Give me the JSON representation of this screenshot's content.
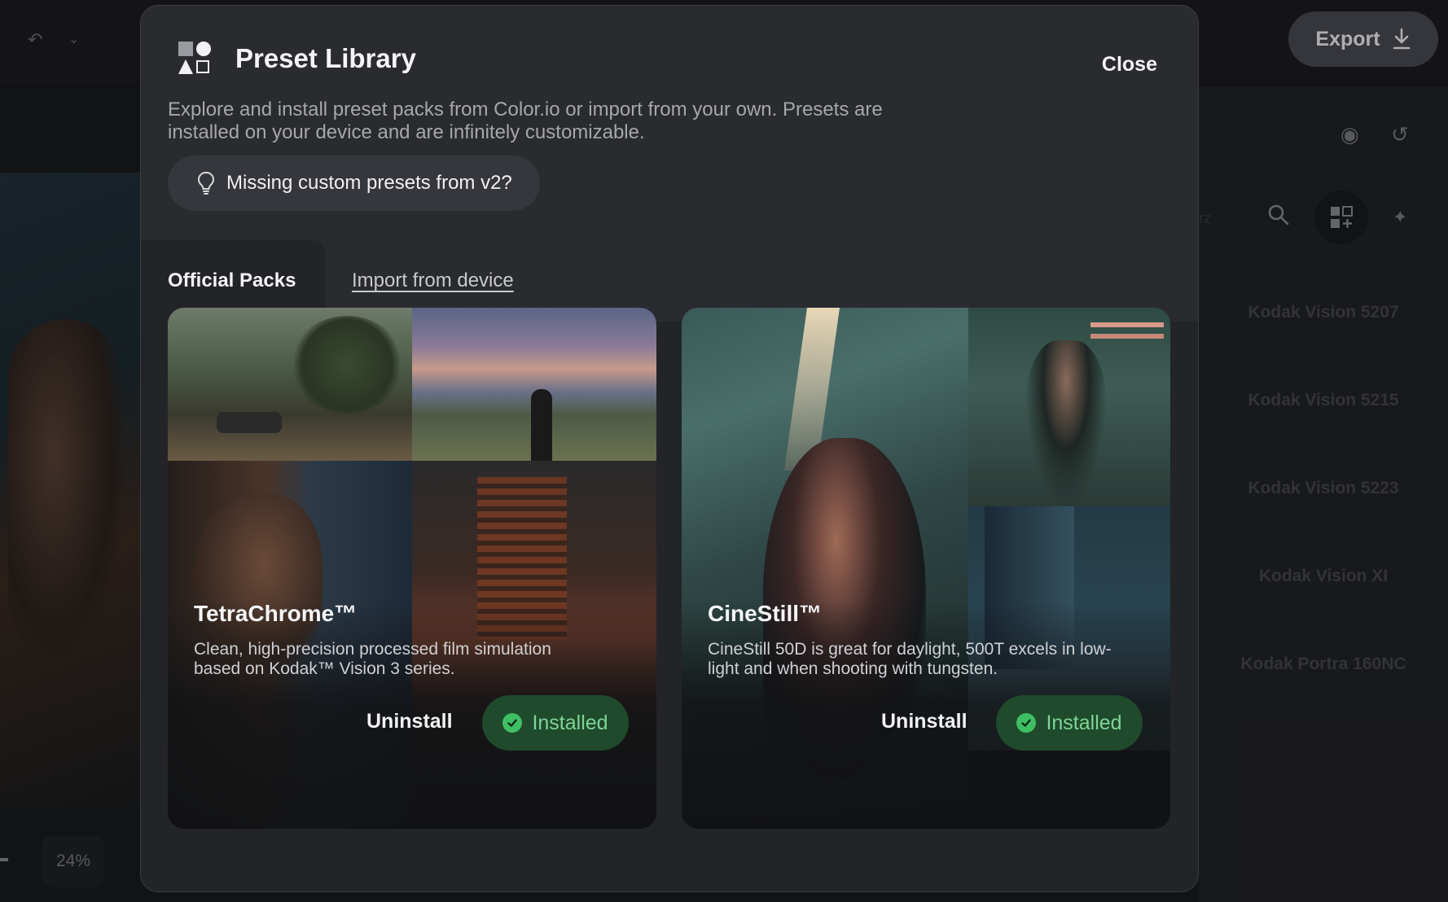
{
  "app": {
    "export_label": "Export",
    "zoom_level": "24%",
    "faint_label": "urz"
  },
  "right_panel": {
    "presets": [
      "Kodak Vision 5207",
      "Kodak Vision 5215",
      "Kodak Vision 5223",
      "Kodak Vision XI",
      "Kodak Portra 160NC"
    ]
  },
  "modal": {
    "title": "Preset Library",
    "close_label": "Close",
    "description": "Explore and install preset packs from Color.io or import from your own. Presets are installed on your device and are infinitely customizable.",
    "v2_notice": "Missing custom presets from v2?",
    "tabs": [
      {
        "label": "Official Packs",
        "active": true
      },
      {
        "label": "Import from device",
        "active": false
      }
    ],
    "packs": [
      {
        "title": "TetraChrome™",
        "description": "Clean, high-precision processed film simulation based on Kodak™ Vision 3 series.",
        "uninstall_label": "Uninstall",
        "status_label": "Installed"
      },
      {
        "title": "CineStill™",
        "description": "CineStill 50D is great for daylight, 500T excels in low-light and when shooting with tungsten.",
        "uninstall_label": "Uninstall",
        "status_label": "Installed"
      }
    ]
  },
  "colors": {
    "modal_bg": "#2a2b2f",
    "installed_bg": "#1f4a2c",
    "installed_text": "#7fd495",
    "check_green": "#3fbf63"
  },
  "icons": {
    "logo": "shapes-logo-icon",
    "notice": "lightbulb-icon",
    "export": "download-icon",
    "installed": "check-circle-icon"
  }
}
